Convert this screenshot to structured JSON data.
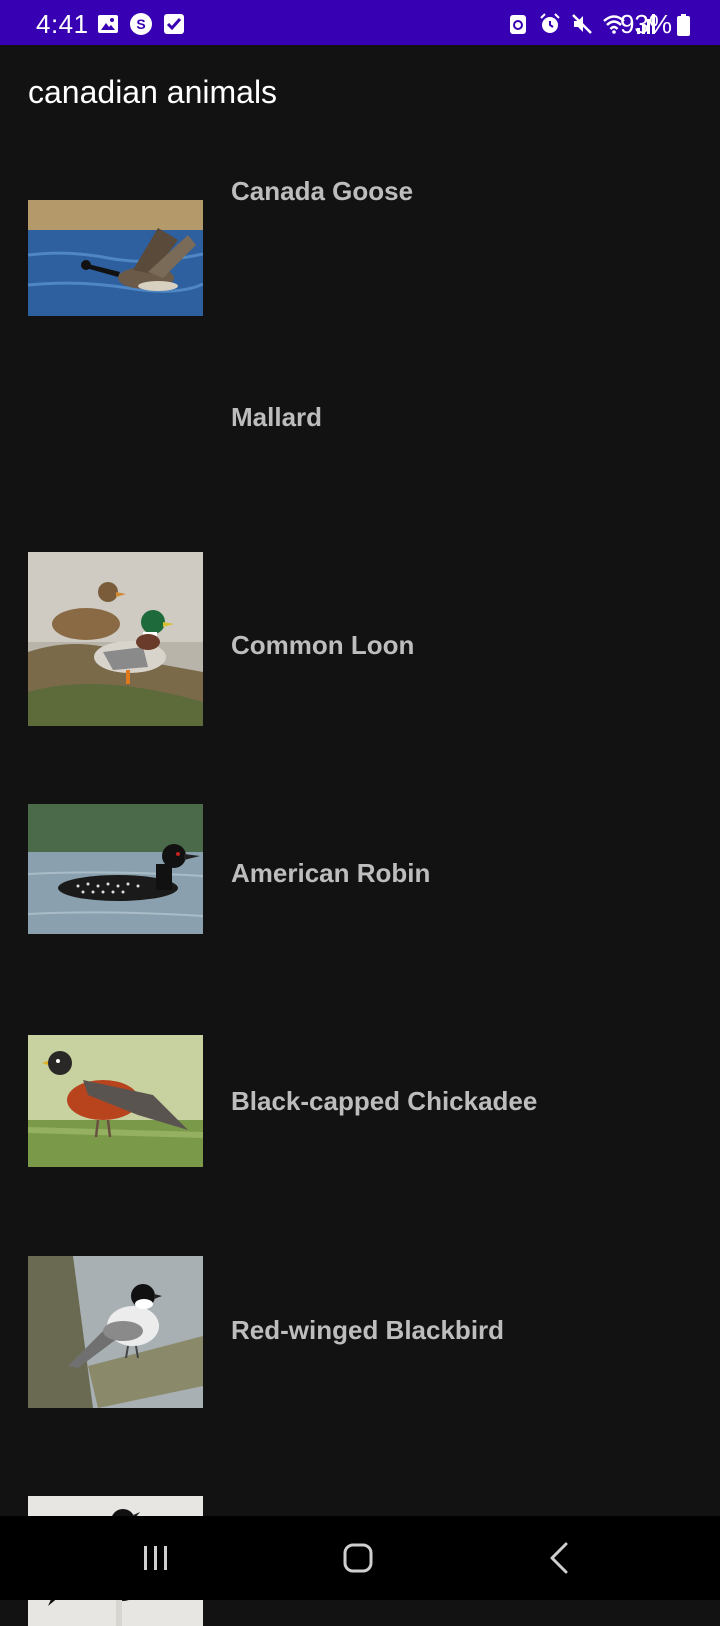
{
  "status_bar": {
    "time": "4:41",
    "battery_percent": "93%",
    "background_color": "#3700b3",
    "left_icons": [
      "gallery-icon",
      "s-app-icon",
      "checkbox-icon"
    ],
    "right_icons": [
      "recycle-icon",
      "alarm-icon",
      "mute-icon",
      "wifi-icon",
      "signal-icon",
      "battery-icon"
    ]
  },
  "app_bar": {
    "title": "canadian animals"
  },
  "animals": [
    {
      "name": "Canada Goose",
      "image_icon": "canada-goose-photo"
    },
    {
      "name": "Mallard",
      "image_icon": "mallard-photo"
    },
    {
      "name": "Common Loon",
      "image_icon": "common-loon-photo"
    },
    {
      "name": "American Robin",
      "image_icon": "american-robin-photo"
    },
    {
      "name": "Black-capped Chickadee",
      "image_icon": "black-capped-chickadee-photo"
    },
    {
      "name": "Red-winged Blackbird",
      "image_icon": "red-winged-blackbird-photo"
    }
  ],
  "nav_bar": {
    "buttons": [
      "recent-apps-icon",
      "home-icon",
      "back-icon"
    ]
  },
  "colors": {
    "background": "#121212",
    "item_text": "#bdbdbd",
    "title_text": "#ffffff"
  }
}
